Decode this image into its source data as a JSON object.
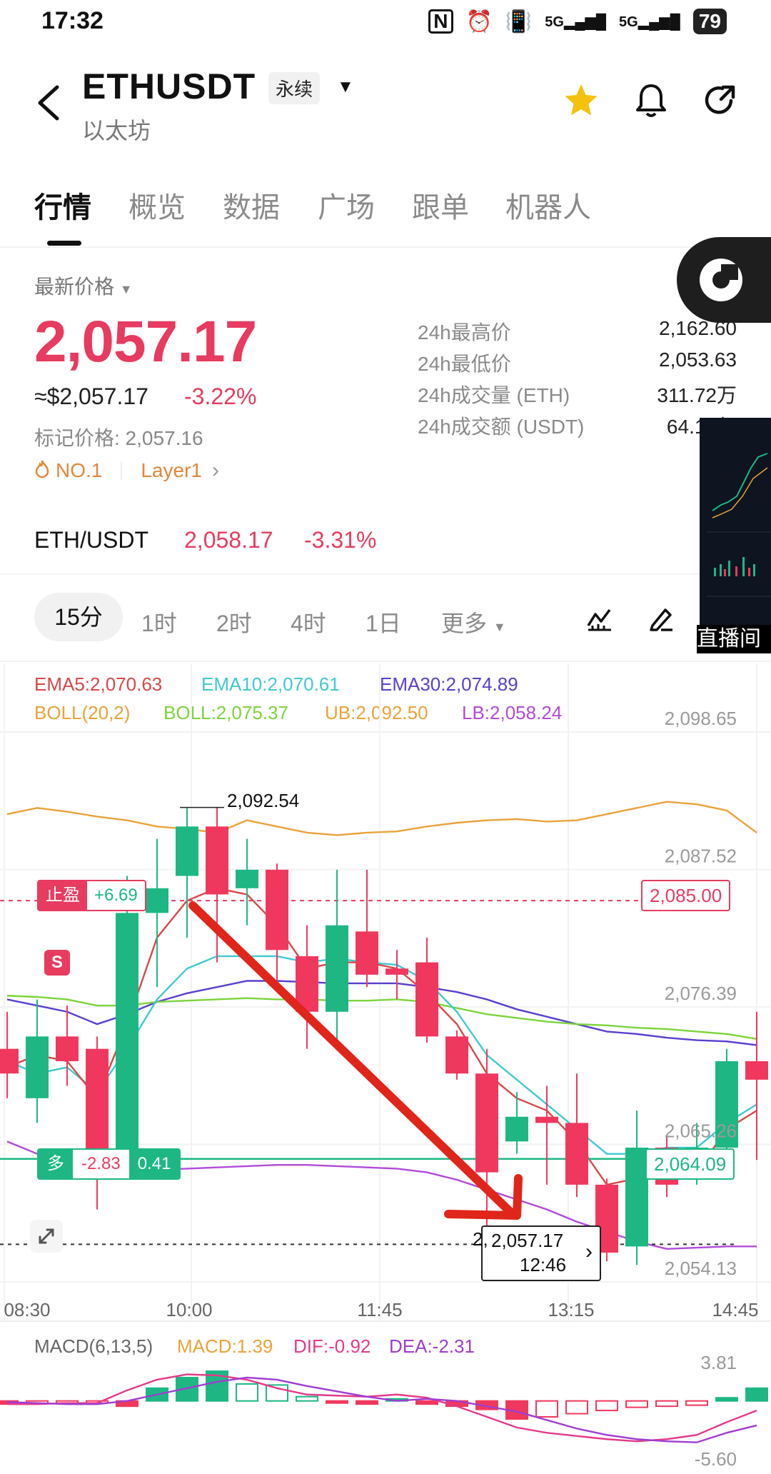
{
  "status": {
    "time": "17:32",
    "battery": "79",
    "signal1": "5G",
    "signal2": "5G"
  },
  "header": {
    "symbol": "ETHUSDT",
    "contract_type": "永续",
    "subtitle": "以太坊"
  },
  "tabs": [
    "行情",
    "概览",
    "数据",
    "广场",
    "跟单",
    "机器人"
  ],
  "ticker": {
    "latest_label": "最新价格",
    "price": "2,057.17",
    "usd_price": "≈$2,057.17",
    "change": "-3.22%",
    "mark_price": "标记价格: 2,057.16",
    "rank_tag": "NO.1",
    "category_tag": "Layer1",
    "stats": [
      {
        "label": "24h最高价",
        "value": "2,162.60"
      },
      {
        "label": "24h最低价",
        "value": "2,053.63"
      },
      {
        "label": "24h成交量 (ETH)",
        "value": "311.72万"
      },
      {
        "label": "24h成交额 (USDT)",
        "value": "64.13亿"
      }
    ],
    "spot_pair": "ETH/USDT",
    "spot_price": "2,058.17",
    "spot_change": "-3.31%"
  },
  "timeframes": {
    "active": "15分",
    "others": [
      "1时",
      "2时",
      "4时",
      "1日"
    ],
    "more": "更多"
  },
  "live_label": "直播间",
  "chart_legend": {
    "ema5": "EMA5:2,070.63",
    "ema10": "EMA10:2,070.61",
    "ema30": "EMA30:2,074.89",
    "boll_params": "BOLL(20,2)",
    "boll": "BOLL:2,075.37",
    "ub": "UB:2,092.50",
    "lb": "LB:2,058.24"
  },
  "chart_labels": {
    "high_marker": "2,092.54",
    "take_profit": "止盈",
    "take_profit_pnl": "+6.69",
    "take_profit_price": "2,085.00",
    "position_side": "多",
    "position_pnl": "-2.83",
    "position_qty": "0.41",
    "position_price": "2,064.09",
    "sell_marker": "S",
    "crosshair_price": "2,057.17",
    "crosshair_time": "12:46",
    "crosshair_partial": "2,",
    "macd_params": "MACD(6,13,5)",
    "macd": "MACD:1.39",
    "dif": "DIF:-0.92",
    "dea": "DEA:-2.31"
  },
  "colors": {
    "up": "#1eb784",
    "down": "#f0385e",
    "accent_red": "#e73b5f",
    "ema5": "#d64848",
    "ema10": "#3fc9cf",
    "ema30": "#5b3fcf",
    "boll_mid": "#7cd43d",
    "boll_ub": "#e9a33b",
    "boll_lb": "#b24bd9",
    "star": "#f4c20d"
  },
  "chart_data": {
    "type": "candlestick",
    "x_tick_labels": [
      "08:30",
      "10:00",
      "11:45",
      "13:15",
      "14:45"
    ],
    "y_tick_labels": [
      "2,098.65",
      "2,087.52",
      "2,076.39",
      "2,065.26",
      "2,054.13"
    ],
    "ylim": [
      2054.13,
      2098.65
    ],
    "candles": [
      {
        "o": 2073.0,
        "c": 2071.0,
        "h": 2076.0,
        "l": 2069.0
      },
      {
        "o": 2069.0,
        "c": 2074.0,
        "h": 2077.0,
        "l": 2067.0
      },
      {
        "o": 2074.0,
        "c": 2072.0,
        "h": 2076.5,
        "l": 2070.0
      },
      {
        "o": 2073.0,
        "c": 2063.0,
        "h": 2074.0,
        "l": 2060.0
      },
      {
        "o": 2063.0,
        "c": 2084.0,
        "h": 2087.0,
        "l": 2063.0
      },
      {
        "o": 2084.0,
        "c": 2086.0,
        "h": 2090.0,
        "l": 2078.0
      },
      {
        "o": 2087.0,
        "c": 2091.0,
        "h": 2092.5,
        "l": 2082.0
      },
      {
        "o": 2091.0,
        "c": 2085.5,
        "h": 2092.54,
        "l": 2080.0
      },
      {
        "o": 2086.0,
        "c": 2087.5,
        "h": 2090.0,
        "l": 2083.0
      },
      {
        "o": 2087.5,
        "c": 2081.0,
        "h": 2088.0,
        "l": 2078.0
      },
      {
        "o": 2080.5,
        "c": 2076.0,
        "h": 2083.0,
        "l": 2073.0
      },
      {
        "o": 2076.0,
        "c": 2083.0,
        "h": 2087.5,
        "l": 2073.0
      },
      {
        "o": 2082.5,
        "c": 2079.0,
        "h": 2087.5,
        "l": 2078.0
      },
      {
        "o": 2079.5,
        "c": 2079.0,
        "h": 2081.0,
        "l": 2077.0
      },
      {
        "o": 2080.0,
        "c": 2074.0,
        "h": 2082.0,
        "l": 2073.5
      },
      {
        "o": 2074.0,
        "c": 2071.0,
        "h": 2074.5,
        "l": 2070.5
      },
      {
        "o": 2071.0,
        "c": 2063.0,
        "h": 2073.0,
        "l": 2058.0
      },
      {
        "o": 2065.5,
        "c": 2067.5,
        "h": 2069.5,
        "l": 2064.5
      },
      {
        "o": 2067.5,
        "c": 2067.0,
        "h": 2070.0,
        "l": 2062.0
      },
      {
        "o": 2067.0,
        "c": 2062.0,
        "h": 2071.0,
        "l": 2061.0
      },
      {
        "o": 2062.0,
        "c": 2056.5,
        "h": 2062.5,
        "l": 2055.8
      },
      {
        "o": 2057.0,
        "c": 2065.0,
        "h": 2068.0,
        "l": 2055.5
      },
      {
        "o": 2065.0,
        "c": 2062.0,
        "h": 2066.0,
        "l": 2061.0
      },
      {
        "o": 2063.0,
        "c": 2065.0,
        "h": 2067.0,
        "l": 2062.0
      },
      {
        "o": 2065.0,
        "c": 2072.0,
        "h": 2073.0,
        "l": 2064.0
      },
      {
        "o": 2072.0,
        "c": 2070.5,
        "h": 2076.0,
        "l": 2064.0
      }
    ],
    "overlays": {
      "boll_ub": [
        2092.0,
        2092.5,
        2092.2,
        2091.8,
        2091.5,
        2091.0,
        2090.8,
        2090.5,
        2091.5,
        2091.0,
        2090.5,
        2090.3,
        2090.5,
        2090.6,
        2091.0,
        2091.3,
        2091.5,
        2091.6,
        2091.4,
        2091.5,
        2092.0,
        2092.5,
        2093.0,
        2092.8,
        2092.3,
        2090.5
      ],
      "ema30": [
        2077.0,
        2076.5,
        2076.0,
        2075.0,
        2075.8,
        2076.8,
        2077.5,
        2078.0,
        2078.5,
        2078.5,
        2078.4,
        2078.3,
        2078.3,
        2078.3,
        2078.0,
        2077.6,
        2077.0,
        2076.2,
        2075.6,
        2075.0,
        2074.4,
        2074.2,
        2073.9,
        2073.7,
        2073.6,
        2073.3
      ],
      "boll_mid": [
        2077.3,
        2077.2,
        2077.0,
        2076.5,
        2076.5,
        2076.8,
        2076.9,
        2077.0,
        2077.1,
        2077.0,
        2077.0,
        2076.9,
        2076.9,
        2077.0,
        2076.8,
        2076.3,
        2075.8,
        2075.5,
        2075.2,
        2075.0,
        2074.9,
        2074.7,
        2074.6,
        2074.4,
        2074.2,
        2073.8
      ],
      "ema10": [
        2072.0,
        2071.0,
        2071.5,
        2069.5,
        2073.0,
        2077.0,
        2079.5,
        2080.5,
        2080.5,
        2080.5,
        2080.0,
        2080.3,
        2080.0,
        2079.8,
        2078.5,
        2076.0,
        2072.5,
        2070.5,
        2068.5,
        2066.5,
        2064.5,
        2064.5,
        2065.0,
        2065.0,
        2067.0,
        2068.5
      ],
      "ema5": [
        2071.5,
        2072.5,
        2072.0,
        2069.0,
        2075.0,
        2082.0,
        2085.0,
        2086.0,
        2085.5,
        2083.0,
        2079.5,
        2080.0,
        2080.0,
        2079.5,
        2077.5,
        2075.0,
        2071.0,
        2069.0,
        2068.0,
        2065.5,
        2062.0,
        2062.5,
        2062.5,
        2063.0,
        2066.5,
        2068.0
      ],
      "boll_lb": [
        2065.5,
        2064.5,
        2064.0,
        2063.5,
        2063.3,
        2063.2,
        2063.3,
        2063.4,
        2063.5,
        2063.6,
        2063.6,
        2063.5,
        2063.4,
        2063.3,
        2063.0,
        2062.4,
        2061.6,
        2060.8,
        2060.0,
        2059.0,
        2058.2,
        2057.4,
        2056.8,
        2056.9,
        2057.0,
        2057.0
      ]
    },
    "price_lines": {
      "take_profit": 2085.0,
      "position": 2064.09,
      "last": 2057.17
    },
    "macd": {
      "ylim": [
        -5.6,
        3.81
      ],
      "y_tick_labels": [
        "3.81",
        "-5.60"
      ],
      "hist": [
        -0.3,
        -0.25,
        -0.2,
        -0.15,
        -0.5,
        1.2,
        2.2,
        2.8,
        1.6,
        1.5,
        0.4,
        -0.2,
        -0.3,
        0.2,
        -0.3,
        -0.5,
        -0.8,
        -1.7,
        -1.5,
        -1.2,
        -0.9,
        -0.6,
        -0.5,
        -0.4,
        0.3,
        1.2
      ],
      "dif": [
        -0.3,
        -0.3,
        -0.2,
        -0.2,
        1.0,
        2.0,
        2.5,
        2.4,
        2.0,
        1.2,
        0.6,
        0.5,
        0.4,
        0.6,
        0.3,
        -0.5,
        -1.5,
        -2.5,
        -3.0,
        -3.3,
        -3.6,
        -3.8,
        -3.6,
        -3.2,
        -2.0,
        -0.9
      ],
      "dea": [
        -0.1,
        -0.2,
        -0.3,
        -0.3,
        0.0,
        0.6,
        1.2,
        1.8,
        2.2,
        2.0,
        1.4,
        0.9,
        0.4,
        0.0,
        0.2,
        0.0,
        -0.5,
        -1.0,
        -1.8,
        -2.6,
        -3.2,
        -3.6,
        -3.8,
        -3.9,
        -3.0,
        -2.3
      ]
    }
  }
}
